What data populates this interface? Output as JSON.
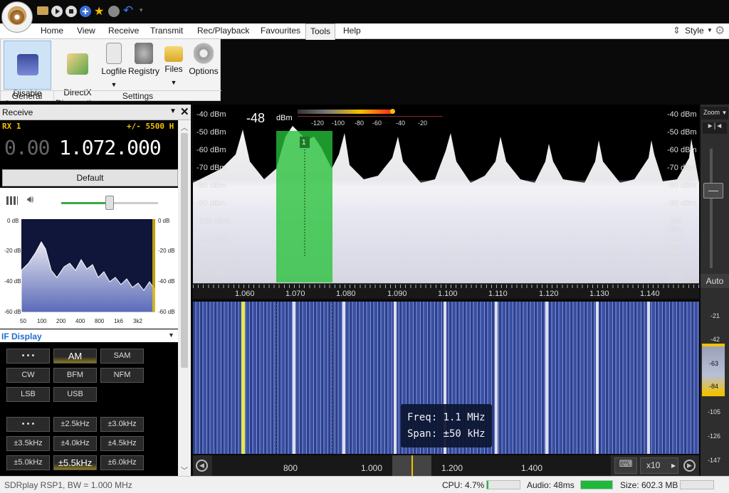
{
  "ribbon_tabs": [
    "Home",
    "View",
    "Receive",
    "Transmit",
    "Rec/Playback",
    "Favourites",
    "Tools",
    "Help"
  ],
  "active_tab": "Tools",
  "style_label": "Style",
  "ribbon": {
    "general_group": "General",
    "settings_group": "Settings",
    "disable_screensaver": "Disable\nScreensaver",
    "directx": "DirectX\nDiagnostics",
    "logfile": "Logfile",
    "registry": "Registry",
    "files": "Files",
    "options": "Options"
  },
  "receive": {
    "title": "Receive",
    "rx": "RX 1",
    "offset": "+/- 5500 H",
    "freq_dim": "0.00",
    "freq_main": "1.072.000",
    "preset": "Default"
  },
  "af_spectrum": {
    "y_labels": [
      "0 dB",
      "-20 dB",
      "-40 dB",
      "-60 dB"
    ],
    "x_labels": [
      "50",
      "100",
      "200",
      "400",
      "800",
      "1k6",
      "3k2"
    ]
  },
  "if_display": {
    "title": "IF Display",
    "modes": [
      "• • •",
      "AM",
      "SAM",
      "CW",
      "BFM",
      "NFM",
      "LSB",
      "USB"
    ],
    "selected_mode": "AM",
    "bandwidths": [
      "• • •",
      "±2.5kHz",
      "±3.0kHz",
      "±3.5kHz",
      "±4.0kHz",
      "±4.5kHz",
      "±5.0kHz",
      "±5.5kHz",
      "±6.0kHz"
    ],
    "selected_bw": "±5.5kHz"
  },
  "spectrum": {
    "level_value": "-48",
    "level_unit": "dBm",
    "meter_scale": [
      "-120",
      "-100",
      "-80",
      "-60",
      "-40",
      "-20"
    ],
    "db_labels": [
      "-40 dBm",
      "-50 dBm",
      "-60 dBm",
      "-70 dBm",
      "-80 dBm",
      "-90 dBm",
      "-100 dBm",
      "-110 dBm",
      "-120 dBm",
      "-130 dBm"
    ],
    "freq_ticks": [
      "1.060",
      "1.070",
      "1.080",
      "1.090",
      "1.100",
      "1.110",
      "1.120",
      "1.130",
      "1.140"
    ],
    "vfo_label": "1"
  },
  "waterfall": {
    "tooltip_freq": "Freq: 1.1 MHz",
    "tooltip_span": "Span: ±50 kHz"
  },
  "overview": {
    "ticks": [
      "800",
      "1.000",
      "1.200",
      "1.400"
    ],
    "zoom_factor": "x10"
  },
  "right_panel": {
    "zoom_label": "Zoom",
    "auto_label": "Auto",
    "levels": [
      "-21",
      "-42",
      "-63",
      "-84",
      "-105",
      "-126",
      "-147"
    ]
  },
  "status": {
    "device": "SDRplay RSP1, BW = 1.000 MHz",
    "cpu": "CPU: 4.7%",
    "cpu_fraction": 0.047,
    "audio": "Audio: 48ms",
    "audio_fraction": 1.0,
    "size": "Size: 602.3 MB"
  },
  "colors": {
    "accent_blue": "#1f6fd0",
    "vfo_green": "#27c23a",
    "amber": "#f2c200",
    "peak_yellow": "#e8e84a"
  }
}
